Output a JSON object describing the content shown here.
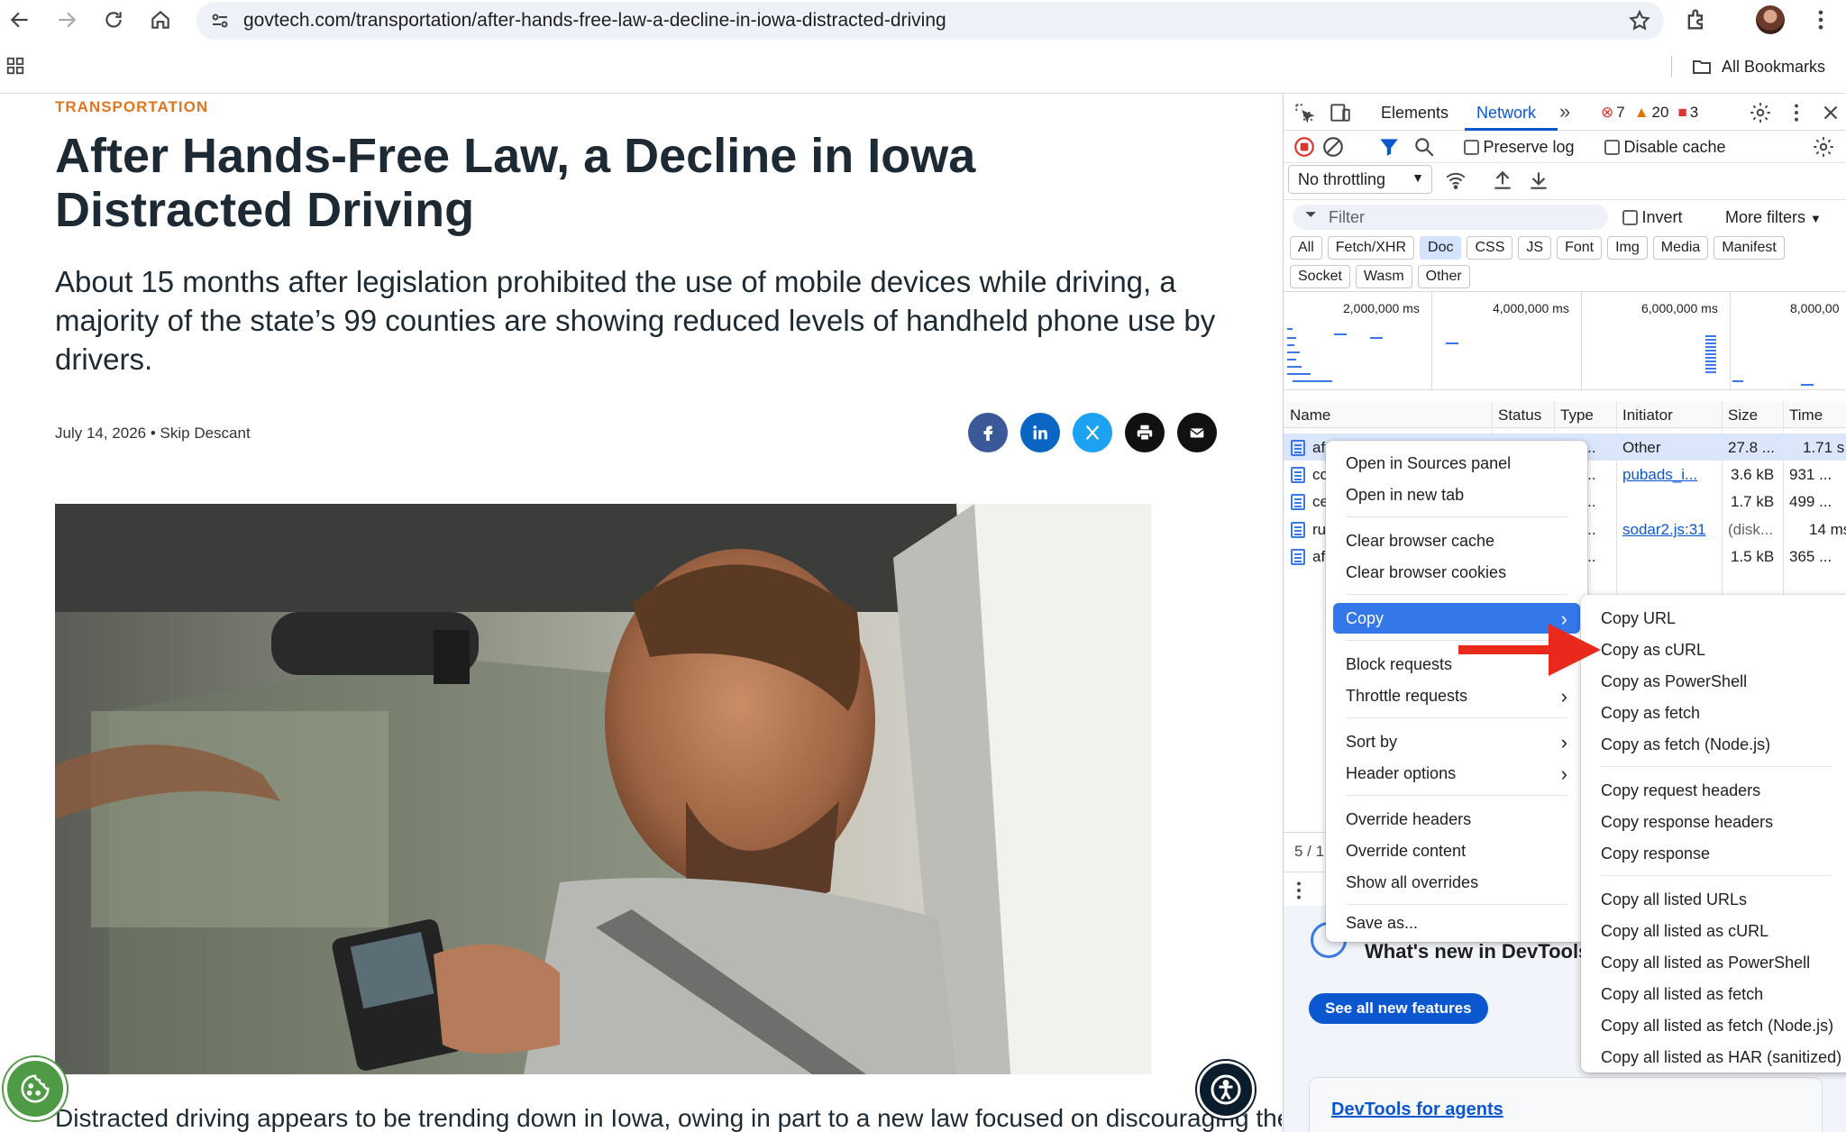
{
  "browser": {
    "url": "govtech.com/transportation/after-hands-free-law-a-decline-in-iowa-distracted-driving",
    "bookmarks_label": "All Bookmarks"
  },
  "article": {
    "category": "TRANSPORTATION",
    "headline": "After Hands-Free Law, a Decline in Iowa Distracted Driving",
    "dek": "About 15 months after legislation prohibited the use of mobile devices while driving, a majority of the state’s 99 counties are showing reduced levels of handheld phone use by drivers.",
    "byline": "July 14, 2026 • Skip Descant",
    "share": [
      {
        "name": "facebook",
        "color": "#3b5998"
      },
      {
        "name": "linkedin",
        "color": "#0a66c2"
      },
      {
        "name": "x-twitter",
        "color": "#1da1f2"
      },
      {
        "name": "print",
        "color": "#111111"
      },
      {
        "name": "email",
        "color": "#111111"
      }
    ],
    "body_start": "Distracted driving appears to be trending down in Iowa, owing in part to a new law focused on discouraging the"
  },
  "devtools": {
    "tabs": [
      "Elements",
      "Network"
    ],
    "active_tab": "Network",
    "errors": "7",
    "warnings": "20",
    "issues": "3",
    "preserve_log": "Preserve log",
    "disable_cache": "Disable cache",
    "throttling": "No throttling",
    "filter_placeholder": "Filter",
    "invert": "Invert",
    "more_filters": "More filters",
    "chips": [
      "All",
      "Fetch/XHR",
      "Doc",
      "CSS",
      "JS",
      "Font",
      "Img",
      "Media",
      "Manifest",
      "Socket",
      "Wasm",
      "Other"
    ],
    "selected_chip": "Doc",
    "timeline_labels": [
      "2,000,000 ms",
      "4,000,000 ms",
      "6,000,000 ms",
      "8,000,00"
    ],
    "columns": [
      "Name",
      "Status",
      "Type",
      "Initiator",
      "Size",
      "Time"
    ],
    "rows": [
      {
        "name": "af",
        "type": "u...",
        "initiator": "Other",
        "initiator_link": false,
        "size": "27.8 ...",
        "time": "1.71 s"
      },
      {
        "name": "co",
        "type": "u...",
        "initiator": "pubads_i...",
        "initiator_link": true,
        "size": "3.6 kB",
        "time": "931 ..."
      },
      {
        "name": "ce",
        "type": "u...",
        "initiator": "",
        "initiator_link": false,
        "size": "1.7 kB",
        "time": "499 ..."
      },
      {
        "name": "ru",
        "type": "u...",
        "initiator": "sodar2.js:31",
        "initiator_link": true,
        "size": "(disk...",
        "time": "14 ms"
      },
      {
        "name": "af",
        "type": "u...",
        "initiator": "",
        "initiator_link": false,
        "size": "1.5 kB",
        "time": "365 ..."
      }
    ],
    "footer_status": "5 / 1",
    "whats_new": "What's new in DevTools",
    "see_all": "See all new features",
    "agents_link": "DevTools for agents"
  },
  "context_menu": {
    "items": [
      "Open in Sources panel",
      "Open in new tab",
      "Clear browser cache",
      "Clear browser cookies",
      "Copy",
      "Block requests",
      "Throttle requests",
      "Sort by",
      "Header options",
      "Override headers",
      "Override content",
      "Show all overrides",
      "Save as..."
    ],
    "highlighted": "Copy"
  },
  "copy_submenu": {
    "items": [
      "Copy URL",
      "Copy as cURL",
      "Copy as PowerShell",
      "Copy as fetch",
      "Copy as fetch (Node.js)",
      "Copy request headers",
      "Copy response headers",
      "Copy response",
      "Copy all listed URLs",
      "Copy all listed as cURL",
      "Copy all listed as PowerShell",
      "Copy all listed as fetch",
      "Copy all listed as fetch (Node.js)",
      "Copy all listed as HAR (sanitized)"
    ],
    "pointed_item": "Copy as cURL",
    "arrow_color": "#e8291c"
  }
}
